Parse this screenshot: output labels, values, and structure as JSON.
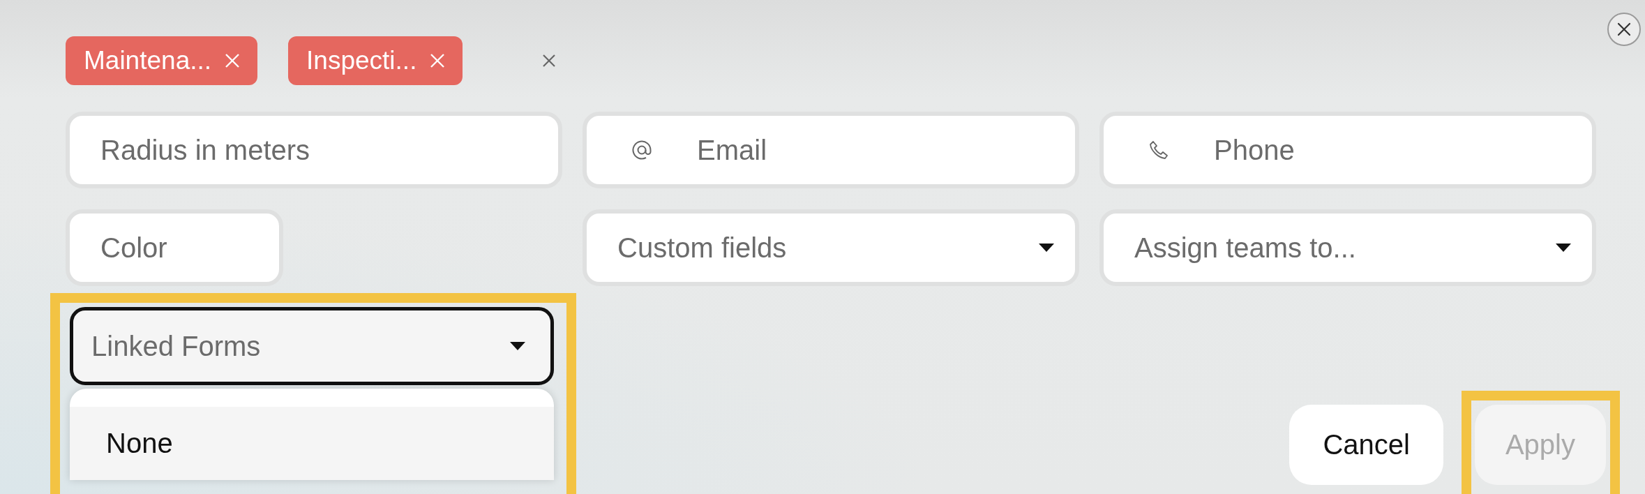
{
  "tags": [
    {
      "label": "Maintena..."
    },
    {
      "label": "Inspecti..."
    }
  ],
  "fields": [
    {
      "kind": "text",
      "placeholder": "Radius in meters"
    },
    {
      "kind": "email",
      "placeholder": "Email"
    },
    {
      "kind": "phone",
      "placeholder": "Phone"
    },
    {
      "kind": "short",
      "placeholder": "Color"
    },
    {
      "kind": "select",
      "placeholder": "Custom fields"
    },
    {
      "kind": "select",
      "placeholder": "Assign teams to..."
    }
  ],
  "linked_forms": {
    "placeholder": "Linked Forms",
    "expanded": true,
    "highlighted": true,
    "options": [
      {
        "label": "None",
        "selected": false
      }
    ]
  },
  "buttons": [
    {
      "label": "Cancel",
      "disabled": false,
      "highlighted": false
    },
    {
      "label": "Apply",
      "disabled": true,
      "highlighted": true
    }
  ]
}
